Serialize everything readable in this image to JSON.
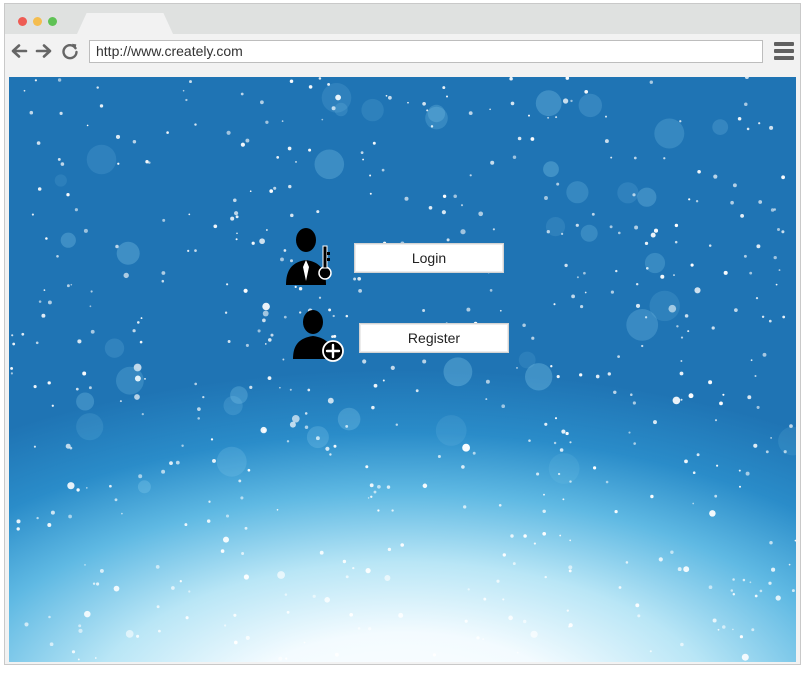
{
  "browser": {
    "url": "http://www.creately.com",
    "colors": {
      "close": "#ee5c54",
      "minimize": "#f4bd4f",
      "maximize": "#5fc255"
    }
  },
  "page": {
    "login_label": "Login",
    "register_label": "Register"
  },
  "icons": {
    "login": "user-key-icon",
    "register": "user-add-icon"
  }
}
